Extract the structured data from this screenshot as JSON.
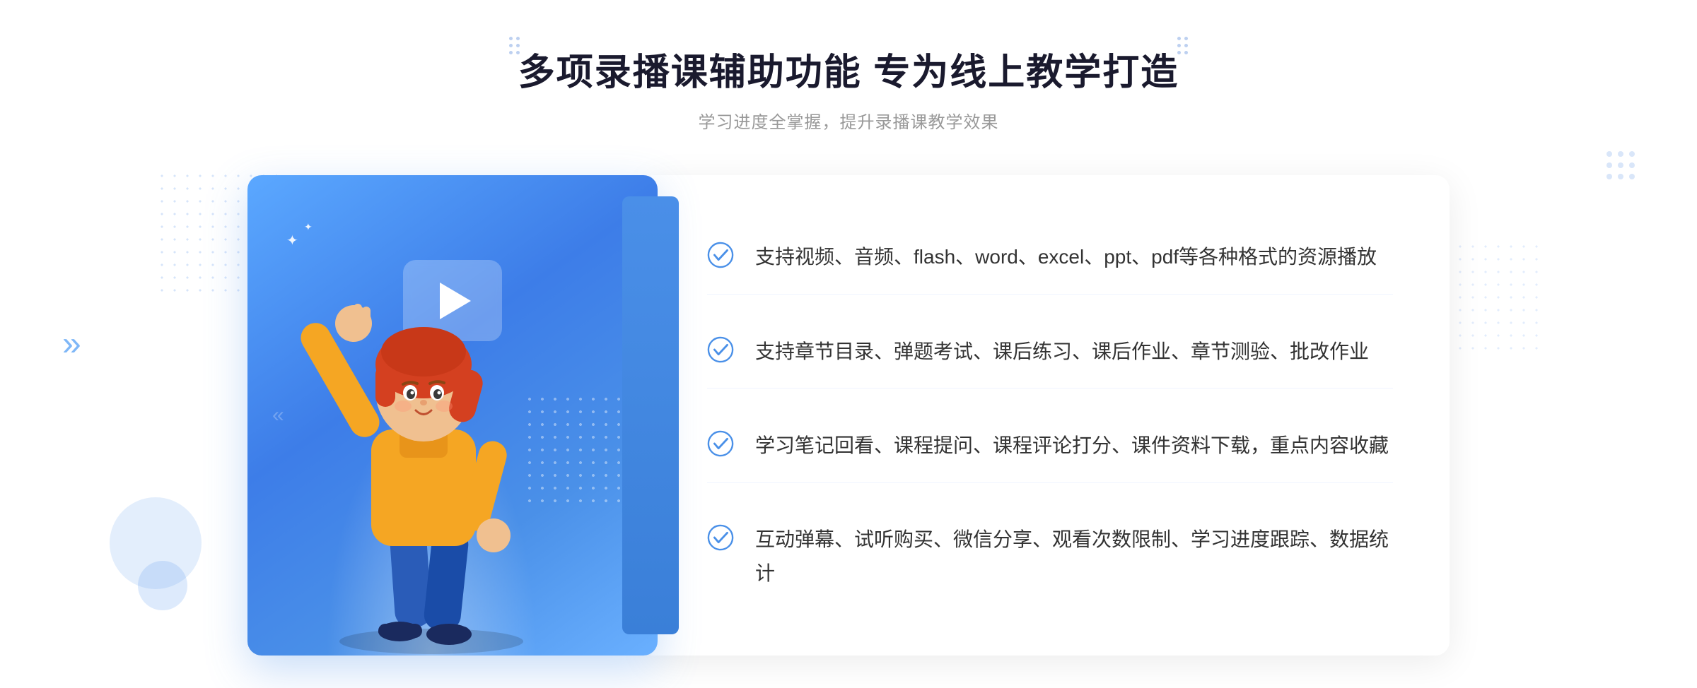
{
  "header": {
    "title": "多项录播课辅助功能 专为线上教学打造",
    "subtitle": "学习进度全掌握，提升录播课教学效果"
  },
  "decoration": {
    "chevron_left": "»",
    "chevron_right": "··"
  },
  "features": [
    {
      "id": 1,
      "text": "支持视频、音频、flash、word、excel、ppt、pdf等各种格式的资源播放"
    },
    {
      "id": 2,
      "text": "支持章节目录、弹题考试、课后练习、课后作业、章节测验、批改作业"
    },
    {
      "id": 3,
      "text": "学习笔记回看、课程提问、课程评论打分、课件资料下载，重点内容收藏"
    },
    {
      "id": 4,
      "text": "互动弹幕、试听购买、微信分享、观看次数限制、学习进度跟踪、数据统计"
    }
  ],
  "colors": {
    "primary": "#4a90e8",
    "title": "#1a1a2e",
    "subtitle": "#999999",
    "feature_text": "#333333",
    "check_color": "#4a90e8",
    "bg_white": "#ffffff",
    "gradient_start": "#5ba8ff",
    "gradient_end": "#3a7fd8"
  }
}
